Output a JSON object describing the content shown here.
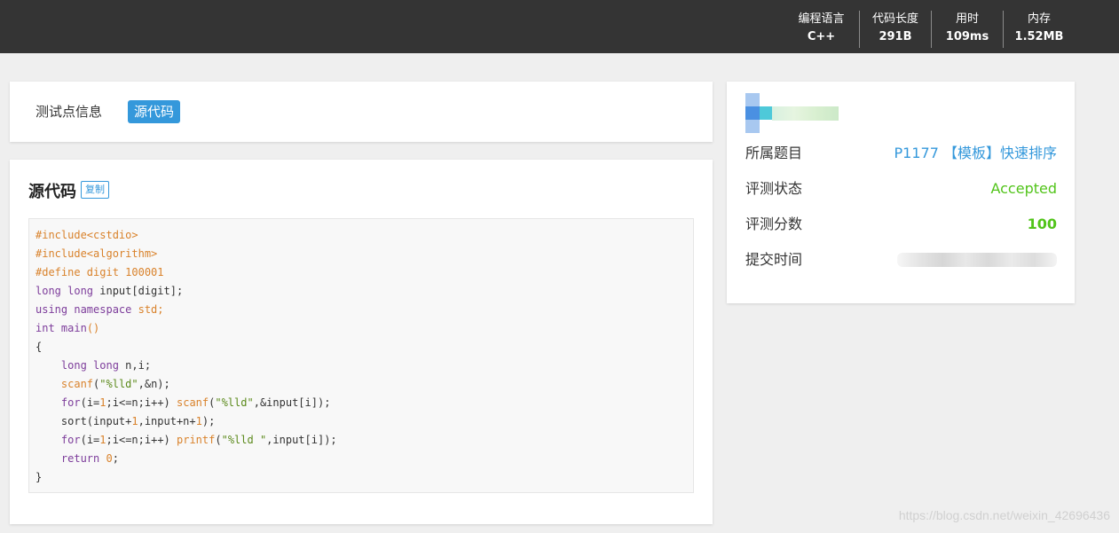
{
  "header": {
    "stats": [
      {
        "label": "编程语言",
        "value": "C++"
      },
      {
        "label": "代码长度",
        "value": "291B"
      },
      {
        "label": "用时",
        "value": "109ms"
      },
      {
        "label": "内存",
        "value": "1.52MB"
      }
    ]
  },
  "tabs": {
    "info_label": "测试点信息",
    "source_label": "源代码"
  },
  "source": {
    "title": "源代码",
    "copy_label": "复制",
    "code_lines": [
      [
        {
          "t": "#include<cstdio>",
          "c": "pre"
        }
      ],
      [
        {
          "t": "#include<algorithm>",
          "c": "pre"
        }
      ],
      [
        {
          "t": "#define digit 100001",
          "c": "pre"
        }
      ],
      [
        {
          "t": "long long",
          "c": "kw"
        },
        {
          "t": " input[digit];",
          "c": ""
        }
      ],
      [
        {
          "t": "using namespace",
          "c": "kw"
        },
        {
          "t": " std;",
          "c": "pre"
        }
      ],
      [
        {
          "t": "int",
          "c": "kw"
        },
        {
          "t": " main",
          "c": "kw"
        },
        {
          "t": "()",
          "c": "fn"
        }
      ],
      [
        {
          "t": "{",
          "c": ""
        }
      ],
      [
        {
          "t": "    ",
          "c": ""
        },
        {
          "t": "long long",
          "c": "kw"
        },
        {
          "t": " n,i;",
          "c": ""
        }
      ],
      [
        {
          "t": "    ",
          "c": ""
        },
        {
          "t": "scanf",
          "c": "fn"
        },
        {
          "t": "(",
          "c": ""
        },
        {
          "t": "\"%lld\"",
          "c": "str"
        },
        {
          "t": ",&n);",
          "c": ""
        }
      ],
      [
        {
          "t": "    ",
          "c": ""
        },
        {
          "t": "for",
          "c": "kw"
        },
        {
          "t": "(i=",
          "c": ""
        },
        {
          "t": "1",
          "c": "num"
        },
        {
          "t": ";i<=n;i++) ",
          "c": ""
        },
        {
          "t": "scanf",
          "c": "fn"
        },
        {
          "t": "(",
          "c": ""
        },
        {
          "t": "\"%lld\"",
          "c": "str"
        },
        {
          "t": ",&input[i]);",
          "c": ""
        }
      ],
      [
        {
          "t": "    sort(input+",
          "c": ""
        },
        {
          "t": "1",
          "c": "num"
        },
        {
          "t": ",input+n+",
          "c": ""
        },
        {
          "t": "1",
          "c": "num"
        },
        {
          "t": ");",
          "c": ""
        }
      ],
      [
        {
          "t": "    ",
          "c": ""
        },
        {
          "t": "for",
          "c": "kw"
        },
        {
          "t": "(i=",
          "c": ""
        },
        {
          "t": "1",
          "c": "num"
        },
        {
          "t": ";i<=n;i++) ",
          "c": ""
        },
        {
          "t": "printf",
          "c": "fn"
        },
        {
          "t": "(",
          "c": ""
        },
        {
          "t": "\"%lld \"",
          "c": "str"
        },
        {
          "t": ",input[i]);",
          "c": ""
        }
      ],
      [
        {
          "t": "    ",
          "c": ""
        },
        {
          "t": "return",
          "c": "kw"
        },
        {
          "t": " ",
          "c": ""
        },
        {
          "t": "0",
          "c": "num"
        },
        {
          "t": ";",
          "c": ""
        }
      ],
      [
        {
          "t": "}",
          "c": ""
        }
      ]
    ]
  },
  "info": {
    "problem_label": "所属题目",
    "problem_value": "P1177 【模板】快速排序",
    "status_label": "评测状态",
    "status_value": "Accepted",
    "score_label": "评测分数",
    "score_value": "100",
    "time_label": "提交时间"
  },
  "watermark": "https://blog.csdn.net/weixin_42696436"
}
